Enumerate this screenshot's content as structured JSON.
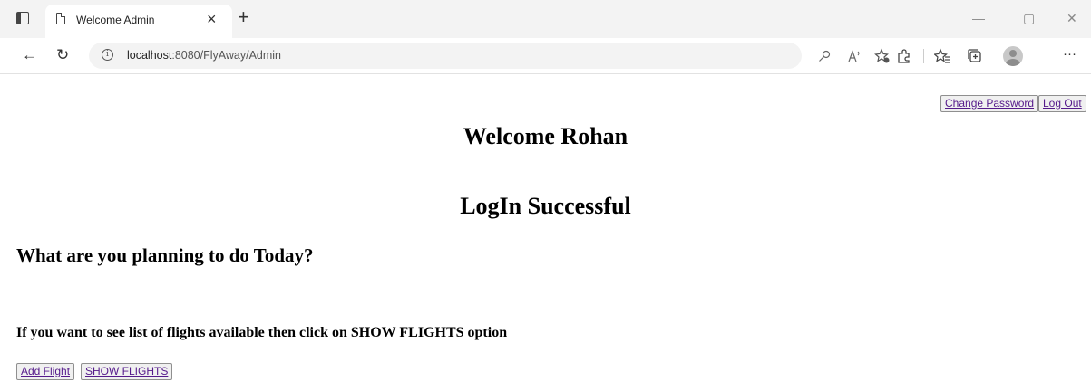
{
  "browser": {
    "tab_title": "Welcome Admin",
    "tab_close": "×",
    "new_tab": "+",
    "url_host": "localhost",
    "url_path": ":8080/FlyAway/Admin",
    "controls": {
      "minimize": "—",
      "restore": "▢",
      "close": "✕",
      "more": "···"
    },
    "nav": {
      "back": "←",
      "refresh": "↻"
    }
  },
  "header_actions": {
    "change_password": "Change Password",
    "log_out": "Log Out"
  },
  "main": {
    "welcome": "Welcome Rohan",
    "login_status": "LogIn Successful",
    "question": "What are you planning to do Today?",
    "info": "If you want to see list of flights available then click on SHOW FLIGHTS option",
    "add_flight": "Add Flight",
    "show_flights": "SHOW FLIGHTS"
  },
  "icons": {
    "tab_actions": "tab-actions-icon",
    "page": "page-icon",
    "info": "info-icon",
    "key": "password-key-icon",
    "read_aloud": "read-aloud-icon",
    "favorite_add": "add-favorite-icon",
    "extensions": "extensions-icon",
    "favorites": "favorites-icon",
    "collections": "collections-icon",
    "profile": "profile-avatar-icon"
  },
  "colors": {
    "link": "#551a8b",
    "chrome_bg": "#f3f3f3",
    "button_bg": "#f0f0f0"
  }
}
